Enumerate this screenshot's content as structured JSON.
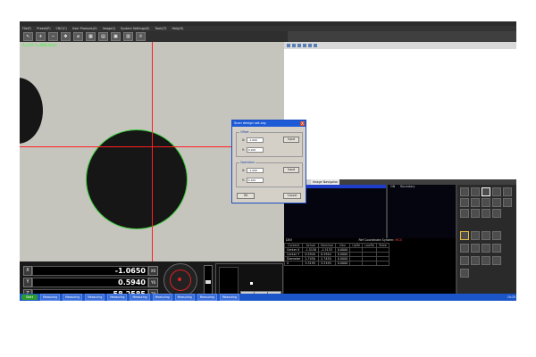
{
  "app": {
    "title": "Measuring",
    "menu": [
      "File(F)",
      "Preset(P)",
      "CNC(C)",
      "User Prompts(U)",
      "Image(I)",
      "System Settings(S)",
      "Tools(T)",
      "Help(H)"
    ],
    "viewport_status": "X=0.5  Y=480.0mm"
  },
  "dialog": {
    "title": "Scan design set.org",
    "close": "X",
    "offset_label": "Offset",
    "operation_label": "Operation",
    "x_label": "X:",
    "y_label": "Y:",
    "offset_x": "-1.000",
    "offset_y": "0.100",
    "op_x": "-1.000",
    "op_y": "0.100",
    "input_label": "Input",
    "ok": "OK",
    "cancel": "Cancel"
  },
  "tabs": [
    "Image",
    "Image Navigator"
  ],
  "list2_headers": [
    "ON",
    "Boundary"
  ],
  "table": {
    "title": "DEV",
    "ref_label": "Ref Coordinate System:",
    "ref_value": "MCS",
    "columns": [
      "Content",
      "Actual",
      "Nominal",
      "Dev",
      "UpTol",
      "LowTol",
      "State"
    ],
    "rows": [
      [
        "Center X",
        "-1.5130",
        "-1.5133",
        "0.0000",
        "",
        "",
        ""
      ],
      [
        "Center Y",
        "0.5944",
        "0.5944",
        "0.0000",
        "",
        "",
        ""
      ],
      [
        "Diameter",
        "2.7450",
        "2.7450",
        "0.0000",
        "",
        "",
        ""
      ],
      [
        "X",
        "3.3195",
        "3.3195",
        "0.0000",
        "",
        "",
        ""
      ]
    ]
  },
  "dro": [
    {
      "axis": "X",
      "value": "-1.0650",
      "btn": "X0"
    },
    {
      "axis": "Y",
      "value": "0.5940",
      "btn": "Y0"
    },
    {
      "axis": "Z",
      "value": "-58.2585",
      "btn": "Z0"
    }
  ],
  "side_buttons": [
    "Lock",
    "Delete",
    "Rotate"
  ],
  "taskbar": {
    "start": "Start",
    "items": [
      "Measuring",
      "Measuring",
      "Measuring",
      "Measuring",
      "Measuring",
      "Measuring",
      "Measuring",
      "Measuring",
      "Measuring"
    ],
    "clock": "10:25"
  },
  "colors": {
    "crosshair": "#ff2020",
    "edge": "#39d039",
    "accent": "#1e5bd6"
  }
}
